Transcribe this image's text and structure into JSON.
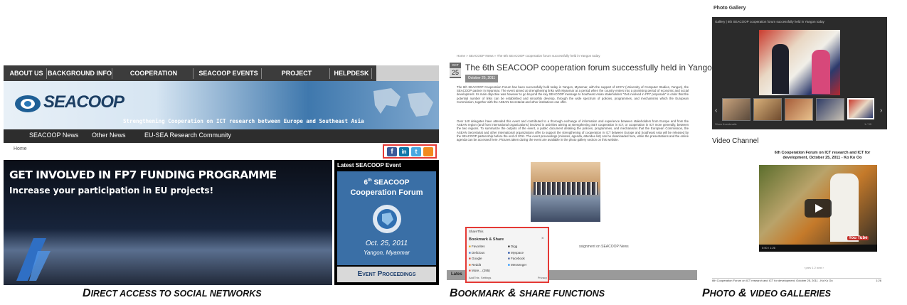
{
  "panel1": {
    "nav_items": [
      "ABOUT US",
      "BACKGROUND INFO",
      "COOPERATION PRIORITIES",
      "SEACOOP EVENTS",
      "PROJECT RESOURCES",
      "HELPDESK"
    ],
    "logo_text": "SEACOOP",
    "banner_tagline": "Strengthening Cooperation on ICT research between Europe and Southeast Asia",
    "subnav_items": [
      "SEACOOP News",
      "Other News",
      "EU-SEA Research Community"
    ],
    "breadcrumb": "Home",
    "social_icons": [
      "facebook-icon",
      "linkedin-icon",
      "twitter-icon",
      "rss-icon"
    ],
    "hero_title": "GET INVOLVED IN FP7 FUNDING PROGRAMME",
    "hero_subtitle": "Increase your participation in EU projects!",
    "event_header": "Latest SEACOOP Event",
    "event_number": "6",
    "event_suffix": "th",
    "event_name": "SEACOOP",
    "event_name2": "Cooperation Forum",
    "event_date": "Oct. 25, 2011",
    "event_place": "Yangon, Myanmar",
    "event_button": "Event Proceedings",
    "highlight_color": "#e53935"
  },
  "panel2": {
    "breadcrumb": "Home » SEACOOP News » The 6th SEACOOP cooperation forum successfully held in Yangon today",
    "date_month": "OCT",
    "date_day": "25",
    "title": "The 6th SEACOOP cooperation forum successfully held in Yangon today",
    "date_badge": "October 25, 2011",
    "paragraph1": "The 6th SEACOOP Cooperation Forum has been successfully held today in Yangon, Myanmar, with the support of UCCY (University of Computer Studies, Yangon), the SEACOOP partner in Myanmar. The event aimed at strengthening links with Myanmar at a period when the country enters into a promising period of economic and social development. Its main objective was however to go beyond the key SEACOOP message to Southeast Asian stakeholders \"Get involved in FP7 proposals\" in order that the potential number of links can be established and smoothly develop, through the wide spectrum of policies, programmes, and mechanisms which the European Commission, together with the ASEAN Secretariat and other institutions can offer.",
    "paragraph2": "Over 140 delegates have attended this event and contributed to a thorough exchange of information and experience between stakeholders from Europe and from the ASEAN region (and from international organizations) involved in activities aiming at strengthening S&T cooperation in ICT, or cooperation in ICT more generally, between the two regions. To summarize the outputs of the event, a public document detailing the policies, programmes, and mechanisms that the European Commission, the ASEAN Secretariat and other international organizations offer to support the strengthening of cooperation in ICT between Europe and Southeast Asia will be released by the SEACOOP partnership before the end of 2011. The event proceedings (minutes, agenda, attendee list) can be downloaded here, while the presentations and the online agenda can be accessed here. Pictures taken during the event are available in the photo gallery section on this website.",
    "bookmark_toolbar": "ShareThis",
    "bookmark_header": "Bookmark & Share",
    "bookmark_col1": [
      "Favorites",
      "Delicious",
      "Google",
      "Reddit",
      "More... (295)"
    ],
    "bookmark_col2": [
      "Digg",
      "Myspace",
      "Facebook",
      "Messenger"
    ],
    "bookmark_footer_left": "AddThis",
    "bookmark_footer_mid": "Settings",
    "bookmark_footer_right": "Privacy",
    "side_link_text": "ssignment on SEACOOP News",
    "footer_tab": "Lates"
  },
  "panel3": {
    "gallery_title": "Photo Gallery",
    "gallery_header": "Gallery | 6th SEACOOP cooperation forum successfully held in Yangon today",
    "gallery_footer_left": "Show thumbnails",
    "gallery_footer_right": "1 / 39",
    "video_title": "Video Channel",
    "video_caption": "6th Cooperation Forum on ICT research and ICT for development, October 25, 2011 - Ko Ko Oo",
    "video_time": "0:00 / 1:26",
    "video_brand": "You Tube",
    "video_pager": "‹ prev  1  2  next ›",
    "video_footer": "6th Cooperation Forum on ICT research and ICT for development, October 25, 2011 - Ko Ko Oo",
    "video_duration": "1:26"
  },
  "captions": {
    "c1_first": "D",
    "c1_rest": "IRECT ACCESS TO SOCIAL NETWORKS",
    "c2_first": "B",
    "c2_rest1": "OOKMARK",
    "c2_amp": " & ",
    "c2_rest2": "SHARE FUNCTIONS",
    "c3_first": "P",
    "c3_rest1": "HOTO",
    "c3_amp": " & ",
    "c3_rest2": "VIDEO GALLERIES"
  }
}
